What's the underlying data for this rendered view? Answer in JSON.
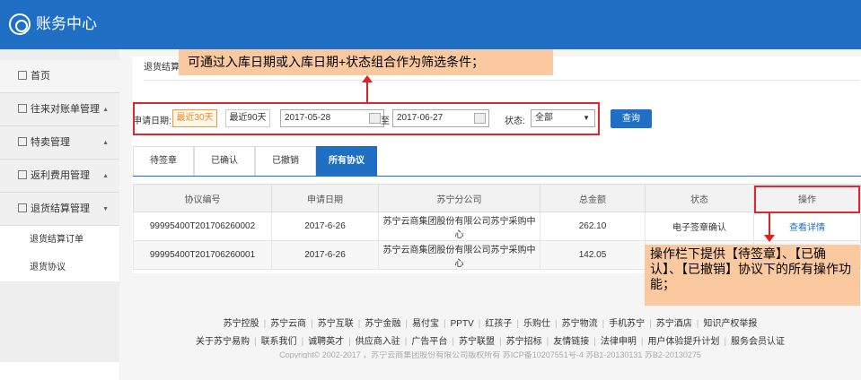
{
  "header": {
    "title": "账务中心"
  },
  "sidebar": {
    "items": [
      {
        "label": "首页",
        "arrow": ""
      },
      {
        "label": "往来对账单管理",
        "arrow": "▲"
      },
      {
        "label": "特卖管理",
        "arrow": "▲"
      },
      {
        "label": "返利费用管理",
        "arrow": "▲"
      },
      {
        "label": "退货结算管理",
        "arrow": "▼"
      }
    ],
    "subitems": [
      "退货结算订单",
      "退货协议"
    ]
  },
  "breadcrumb": "退货结算管",
  "filter": {
    "label": "申请日期:",
    "btn_30": "最近30天",
    "btn_90": "最近90天",
    "date_from": "2017-05-28",
    "to_label": "至",
    "date_to": "2017-06-27",
    "status_label": "状态:",
    "status_value": "全部",
    "query": "查询"
  },
  "tabs": [
    "待签章",
    "已确认",
    "已撤销",
    "所有协议"
  ],
  "table": {
    "headers": [
      "协议编号",
      "申请日期",
      "苏宁分公司",
      "总金额",
      "状态",
      "操作"
    ],
    "rows": [
      [
        "99995400T201706260002",
        "2017-6-26",
        "苏宁云商集团股份有限公司苏宁采购中心",
        "262.10",
        "电子签章确认",
        "查看详情"
      ],
      [
        "99995400T201706260001",
        "2017-6-26",
        "苏宁云商集团股份有限公司苏宁采购中心",
        "142.05",
        "",
        ""
      ]
    ]
  },
  "footer": {
    "row1": [
      "苏宁控股",
      "苏宁云商",
      "苏宁互联",
      "苏宁金融",
      "易付宝",
      "PPTV",
      "红孩子",
      "乐购仕",
      "苏宁物流",
      "手机苏宁",
      "苏宁酒店",
      "知识产权举报"
    ],
    "row2": [
      "关于苏宁易购",
      "联系我们",
      "诚聘英才",
      "供应商入驻",
      "广告平台",
      "苏宁联盟",
      "苏宁招标",
      "友情链接",
      "法律申明",
      "用户体验提升计划",
      "服务会员认证"
    ],
    "copyright": "Copyright© 2002-2017 ，苏宁云商集团股份有限公司版权所有 苏ICP备10207551号-4 苏B1-20130131 苏B2-20130275"
  },
  "annotations": {
    "top": "可通过入库日期或入库日期+状态组合作为筛选条件；",
    "op": "操作栏下提供【待签章】、【已确认】、【已撤销】协议下的所有操作功能；"
  },
  "colors": {
    "brand": "#1f6fc5",
    "callout": "#fbc9a0",
    "highlight": "#e0262e",
    "accent_orange": "#f28a1d"
  }
}
